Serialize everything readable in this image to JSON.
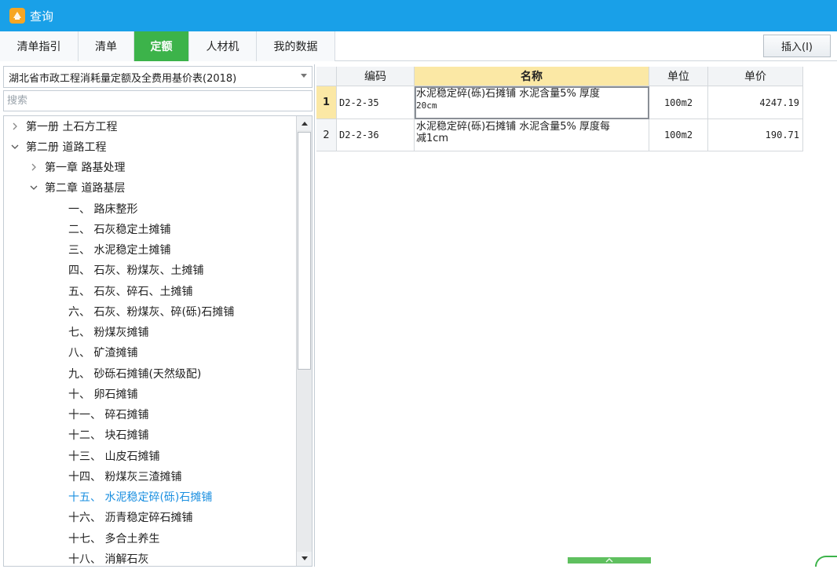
{
  "window": {
    "title": "查询"
  },
  "tabs": [
    {
      "label": "清单指引"
    },
    {
      "label": "清单"
    },
    {
      "label": "定额"
    },
    {
      "label": "人材机"
    },
    {
      "label": "我的数据"
    }
  ],
  "toolbar": {
    "insert_label": "插入(I)"
  },
  "left": {
    "selected_reference": "湖北省市政工程消耗量定额及全费用基价表(2018)",
    "search_placeholder": "搜索",
    "tree": [
      {
        "label": "第一册 土石方工程"
      },
      {
        "label": "第二册 道路工程"
      },
      {
        "label": "第一章 路基处理"
      },
      {
        "label": "第二章 道路基层"
      },
      {
        "label": "一、 路床整形"
      },
      {
        "label": "二、 石灰稳定土摊铺"
      },
      {
        "label": "三、 水泥稳定土摊铺"
      },
      {
        "label": "四、 石灰、粉煤灰、土摊铺"
      },
      {
        "label": "五、 石灰、碎石、土摊铺"
      },
      {
        "label": "六、 石灰、粉煤灰、碎(砾)石摊铺"
      },
      {
        "label": "七、 粉煤灰摊铺"
      },
      {
        "label": "八、 矿渣摊铺"
      },
      {
        "label": "九、 砂砾石摊铺(天然级配)"
      },
      {
        "label": "十、 卵石摊铺"
      },
      {
        "label": "十一、 碎石摊铺"
      },
      {
        "label": "十二、 块石摊铺"
      },
      {
        "label": "十三、 山皮石摊铺"
      },
      {
        "label": "十四、 粉煤灰三渣摊铺"
      },
      {
        "label": "十五、 水泥稳定碎(砾)石摊铺"
      },
      {
        "label": "十六、 沥青稳定碎石摊铺"
      },
      {
        "label": "十七、 多合土养生"
      },
      {
        "label": "十八、 消解石灰"
      }
    ]
  },
  "table": {
    "columns": [
      "编码",
      "名称",
      "单位",
      "单价"
    ],
    "rows": [
      {
        "no": "1",
        "code": "D2-2-35",
        "name_main": "水泥稳定碎(砾)石摊铺 水泥含量5% 厚度",
        "name_tail": "20cm",
        "unit": "100m2",
        "price": "4247.19"
      },
      {
        "no": "2",
        "code": "D2-2-36",
        "name_main": "水泥稳定碎(砾)石摊铺 水泥含量5% 厚度每",
        "name_tail": "减1cm",
        "unit": "100m2",
        "price": "190.71"
      }
    ]
  },
  "colors": {
    "titlebar": "#19a0e8",
    "active_tab": "#3cb34a",
    "highlight_text": "#1a8fe0",
    "sorted_header": "#fbe8a5"
  }
}
